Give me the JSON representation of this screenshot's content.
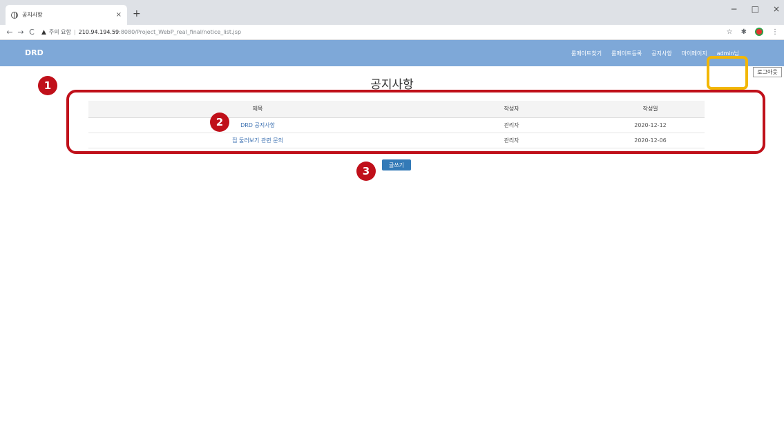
{
  "browser": {
    "tab_title": "공지사항",
    "tab_close": "×",
    "new_tab": "+",
    "win_minimize": "−",
    "win_maximize": "□",
    "win_close": "×",
    "back": "←",
    "forward": "→",
    "reload": "C",
    "warning_icon": "▲",
    "warning_text": "주의 요함",
    "separator": "|",
    "url_host": "210.94.194.59",
    "url_path": ":8080/Project_WebP_real_final/notice_list.jsp",
    "star": "☆",
    "extensions": "✱",
    "menu": "⋮"
  },
  "navbar": {
    "brand": "DRD",
    "links": [
      "룸메이트찾기",
      "룸메이트등록",
      "공지사항",
      "마이페이지",
      "admin님"
    ],
    "logout": "로그아웃",
    "color": "#7ea8d8"
  },
  "main": {
    "title": "공지사항",
    "columns": [
      "제목",
      "작성자",
      "작성일"
    ],
    "rows": [
      {
        "title": "DRD 공지사항",
        "author": "관리자",
        "date": "2020-12-12"
      },
      {
        "title": "집 둘러보기 관련 문의",
        "author": "관리자",
        "date": "2020-12-06"
      }
    ],
    "write_button": "글쓰기"
  },
  "annotations": {
    "badge1": "1",
    "badge2": "2",
    "badge3": "3",
    "highlight_color": "#c0101a",
    "admin_highlight_color": "#f2b705"
  }
}
